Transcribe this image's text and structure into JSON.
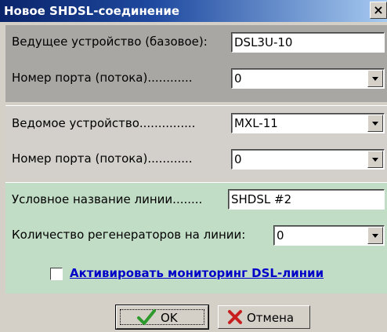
{
  "window": {
    "title": "Новое SHDSL-соединение",
    "close_glyph": "×"
  },
  "master": {
    "device_label": "Ведущее устройство (базовое):",
    "device_value": "DSL3U-10",
    "port_label": "Номер порта (потока)............",
    "port_value": "0"
  },
  "slave": {
    "device_label": "Ведомое устройство...............",
    "device_value": "MXL-11",
    "port_label": "Номер порта (потока)............",
    "port_value": "0"
  },
  "line": {
    "name_label": "Условное название линии........",
    "name_value": "SHDSL #2",
    "regen_label": "Количество регенераторов на линии:",
    "regen_value": "0",
    "monitoring_label": "Активировать мониторинг DSL-линии",
    "monitoring_checked": false
  },
  "buttons": {
    "ok_label": "OK",
    "cancel_label": "Отмена"
  },
  "colors": {
    "title_gradient_start": "#0a246a",
    "title_gradient_end": "#a6caf0",
    "panel1_bg": "#a9a7a3",
    "panel2_bg": "#d3d0cb",
    "panel3_bg": "#c2ddc5",
    "link_color": "#0000c8",
    "ok_icon": "#2e9a2e",
    "cancel_icon": "#c81e1e"
  },
  "icons": {
    "ok": "checkmark-icon",
    "cancel": "x-mark-icon",
    "dropdown": "chevron-down-icon"
  }
}
